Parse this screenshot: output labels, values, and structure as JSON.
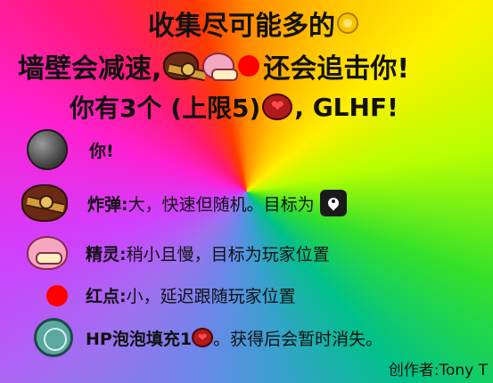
{
  "header": {
    "line1": "收集尽可能多的",
    "line2_prefix": "墙壁会减速,",
    "line2_suffix": "还会追击你!",
    "line3_prefix": "你有3个 (上限5)",
    "line3_suffix": ", GLHF!"
  },
  "legend": {
    "player": {
      "text": "你!"
    },
    "bomb": {
      "name": "炸弹:",
      "desc": "大，快速但随机。目标为"
    },
    "spirit": {
      "name": "精灵:",
      "desc": "稍小且慢，目标为玩家位置"
    },
    "red_dot": {
      "name": "红点:",
      "desc": "小，延迟跟随玩家位置"
    },
    "hp_bubble": {
      "name": "HP泡泡填充1",
      "desc": "。获得后会暂时消失。"
    }
  },
  "credits": "创作者:Tony T",
  "icons": [
    "coin-icon",
    "bomb-icon",
    "spirit-icon",
    "red-dot-icon",
    "heart-icon",
    "player-ball-icon",
    "location-pin-icon",
    "hp-bubble-icon"
  ],
  "colors": {
    "red_dot": "#ff0000",
    "coin": "#f4c400",
    "heart": "#b01a1a"
  }
}
